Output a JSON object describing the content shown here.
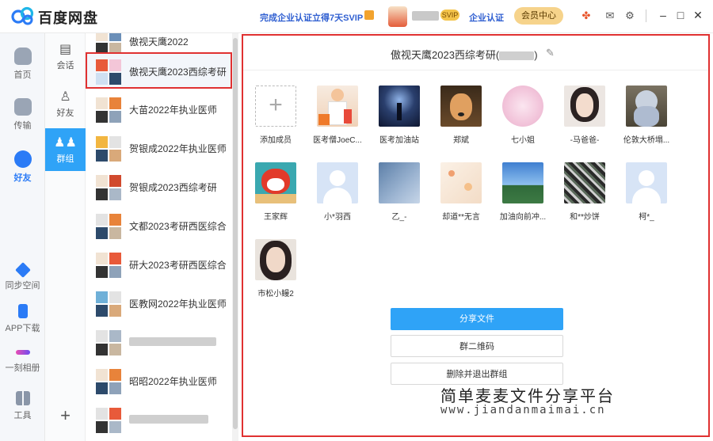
{
  "app": {
    "title": "百度网盘"
  },
  "titlebar": {
    "promo": "完成企业认证立得7天SVIP",
    "svip_badge": "SVIP",
    "enterprise_link": "企业认证",
    "member_center": "会员中心"
  },
  "leftnav": [
    {
      "label": "首页",
      "icon": "cloud-icon"
    },
    {
      "label": "传输",
      "icon": "transfer-icon"
    },
    {
      "label": "好友",
      "icon": "friends-icon",
      "active": true
    },
    {
      "label": "同步空间",
      "icon": "sync-icon"
    },
    {
      "label": "APP下载",
      "icon": "phone-icon"
    },
    {
      "label": "一刻相册",
      "icon": "album-icon"
    },
    {
      "label": "工具",
      "icon": "tools-icon"
    }
  ],
  "categories": [
    {
      "label": "会话",
      "icon": "chat-icon"
    },
    {
      "label": "好友",
      "icon": "person-icon"
    },
    {
      "label": "群组",
      "icon": "group-icon",
      "active": true
    }
  ],
  "groups": [
    {
      "name": "傲视天鹰2022"
    },
    {
      "name": "傲视天鹰2023西综考研",
      "selected": true
    },
    {
      "name": "大苗2022年执业医师"
    },
    {
      "name": "贺银成2022年执业医师"
    },
    {
      "name": "贺银成2023西综考研"
    },
    {
      "name": "文都2023考研西医综合"
    },
    {
      "name": "研大2023考研西医综合"
    },
    {
      "name": "医教网2022年执业医师"
    },
    {
      "name": ""
    },
    {
      "name": "昭昭2022年执业医师"
    },
    {
      "name": ""
    }
  ],
  "panel": {
    "title": "傲视天鹰2023西综考研(",
    "title_suffix": ")",
    "members": [
      {
        "name": "添加成员",
        "kind": "add"
      },
      {
        "name": "医考僧JoeC...",
        "kind": "doctor"
      },
      {
        "name": "医考加油站",
        "kind": "night"
      },
      {
        "name": "郑斌",
        "kind": "dog"
      },
      {
        "name": "七小姐",
        "kind": "pink"
      },
      {
        "name": "-马爸爸-",
        "kind": "girl"
      },
      {
        "name": "伦敦大桥塌...",
        "kind": "bear"
      },
      {
        "name": "王家辉",
        "kind": "fox"
      },
      {
        "name": "小*羽西",
        "kind": "default"
      },
      {
        "name": "乙_-",
        "kind": "blueart"
      },
      {
        "name": "却道**无言",
        "kind": "flowers"
      },
      {
        "name": "加油向前冲...",
        "kind": "sky"
      },
      {
        "name": "和**炒饼",
        "kind": "sketch"
      },
      {
        "name": "柯*_",
        "kind": "default"
      },
      {
        "name": "市松小鳗2",
        "kind": "woman"
      }
    ],
    "buttons": {
      "share": "分享文件",
      "qrcode": "群二维码",
      "delete_exit": "删除并退出群组"
    }
  },
  "watermark": {
    "line1": "简单麦麦文件分享平台",
    "line2": "www.jiandanmaimai.cn"
  }
}
